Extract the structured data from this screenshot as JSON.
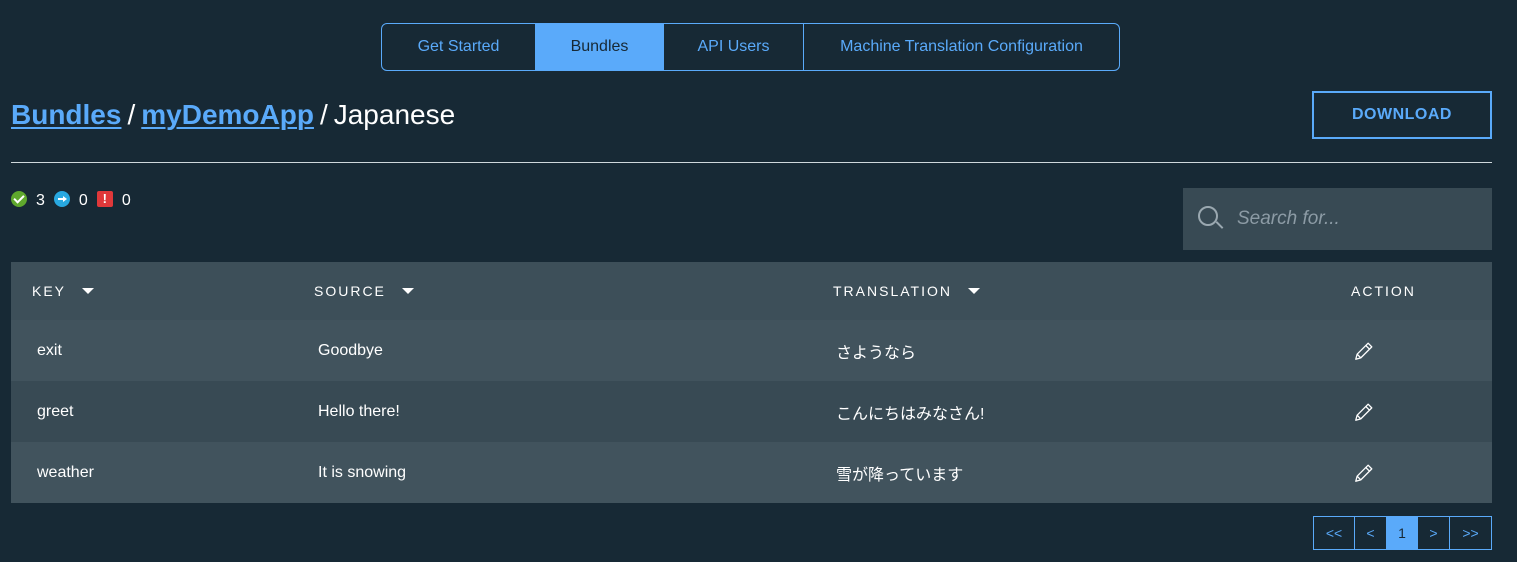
{
  "tabs": [
    {
      "label": "Get Started",
      "active": false
    },
    {
      "label": "Bundles",
      "active": true
    },
    {
      "label": "API Users",
      "active": false
    },
    {
      "label": "Machine Translation Configuration",
      "active": false
    }
  ],
  "breadcrumb": {
    "root": "Bundles",
    "bundle": "myDemoApp",
    "separator": "/",
    "current": "Japanese"
  },
  "download_label": "DOWNLOAD",
  "status": {
    "translated_count": "3",
    "in_progress_count": "0",
    "error_count": "0"
  },
  "search": {
    "placeholder": "Search for...",
    "value": ""
  },
  "table": {
    "headers": {
      "key": "KEY",
      "source": "SOURCE",
      "translation": "TRANSLATION",
      "action": "ACTION"
    },
    "rows": [
      {
        "key": "exit",
        "source": "Goodbye",
        "translation": "さようなら",
        "action_icon": "pencil-icon"
      },
      {
        "key": "greet",
        "source": "Hello there!",
        "translation": "こんにちはみなさん!",
        "action_icon": "pencil-icon"
      },
      {
        "key": "weather",
        "source": "It is snowing",
        "translation": "雪が降っています",
        "action_icon": "pencil-icon"
      }
    ]
  },
  "pagination": {
    "first": "<<",
    "prev": "<",
    "current_page": "1",
    "next": ">",
    "last": ">>"
  },
  "colors": {
    "background": "#172935",
    "accent": "#5aaafa",
    "header_row": "#3d4f59",
    "row_odd": "#41535d",
    "row_even": "#384a54",
    "success": "#5fa82d",
    "info": "#28a8e0",
    "error": "#e0383a"
  }
}
